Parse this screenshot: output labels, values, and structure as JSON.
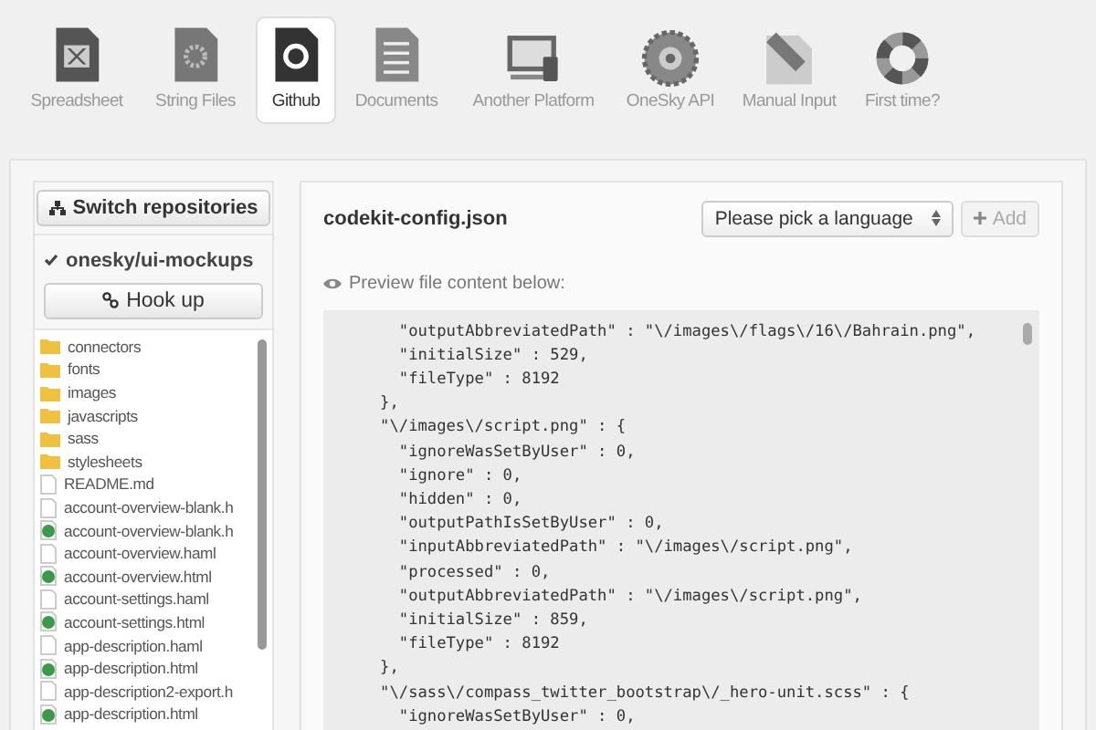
{
  "toolbar": [
    {
      "label": "Spreadsheet",
      "selected": false
    },
    {
      "label": "String Files",
      "selected": false
    },
    {
      "label": "Github",
      "selected": true
    },
    {
      "label": "Documents",
      "selected": false
    },
    {
      "label": "Another Platform",
      "selected": false
    },
    {
      "label": "OneSky API",
      "selected": false
    },
    {
      "label": "Manual Input",
      "selected": false
    },
    {
      "label": "First time?",
      "selected": false
    }
  ],
  "sidebar": {
    "switch_button": "Switch repositories",
    "repository": {
      "name": "onesky/ui-mockups",
      "checked": true
    },
    "hook_button": "Hook up",
    "files": [
      {
        "name": "connectors",
        "kind": "folder"
      },
      {
        "name": "fonts",
        "kind": "folder"
      },
      {
        "name": "images",
        "kind": "folder"
      },
      {
        "name": "javascripts",
        "kind": "folder"
      },
      {
        "name": "sass",
        "kind": "folder"
      },
      {
        "name": "stylesheets",
        "kind": "folder"
      },
      {
        "name": "README.md",
        "kind": "file"
      },
      {
        "name": "account-overview-blank.h",
        "kind": "file"
      },
      {
        "name": "account-overview-blank.h",
        "kind": "html"
      },
      {
        "name": "account-overview.haml",
        "kind": "file"
      },
      {
        "name": "account-overview.html",
        "kind": "html"
      },
      {
        "name": "account-settings.haml",
        "kind": "file"
      },
      {
        "name": "account-settings.html",
        "kind": "html"
      },
      {
        "name": "app-description.haml",
        "kind": "file"
      },
      {
        "name": "app-description.html",
        "kind": "html"
      },
      {
        "name": "app-description2-export.h",
        "kind": "file"
      },
      {
        "name": "app-description.html",
        "kind": "html"
      }
    ]
  },
  "content": {
    "file_name": "codekit-config.json",
    "language_select": {
      "placeholder": "Please pick a language"
    },
    "add_button": "Add",
    "preview_label": "Preview file content below:",
    "code_lines": [
      "        \"outputAbbreviatedPath\" : \"\\/images\\/flags\\/16\\/Bahrain.png\",",
      "        \"initialSize\" : 529,",
      "        \"fileType\" : 8192",
      "      },",
      "      \"\\/images\\/script.png\" : {",
      "        \"ignoreWasSetByUser\" : 0,",
      "        \"ignore\" : 0,",
      "        \"hidden\" : 0,",
      "        \"outputPathIsSetByUser\" : 0,",
      "        \"inputAbbreviatedPath\" : \"\\/images\\/script.png\",",
      "        \"processed\" : 0,",
      "        \"outputAbbreviatedPath\" : \"\\/images\\/script.png\",",
      "        \"initialSize\" : 859,",
      "        \"fileType\" : 8192",
      "      },",
      "      \"\\/sass\\/compass_twitter_bootstrap\\/_hero-unit.scss\" : {",
      "        \"ignoreWasSetByUser\" : 0,"
    ]
  }
}
